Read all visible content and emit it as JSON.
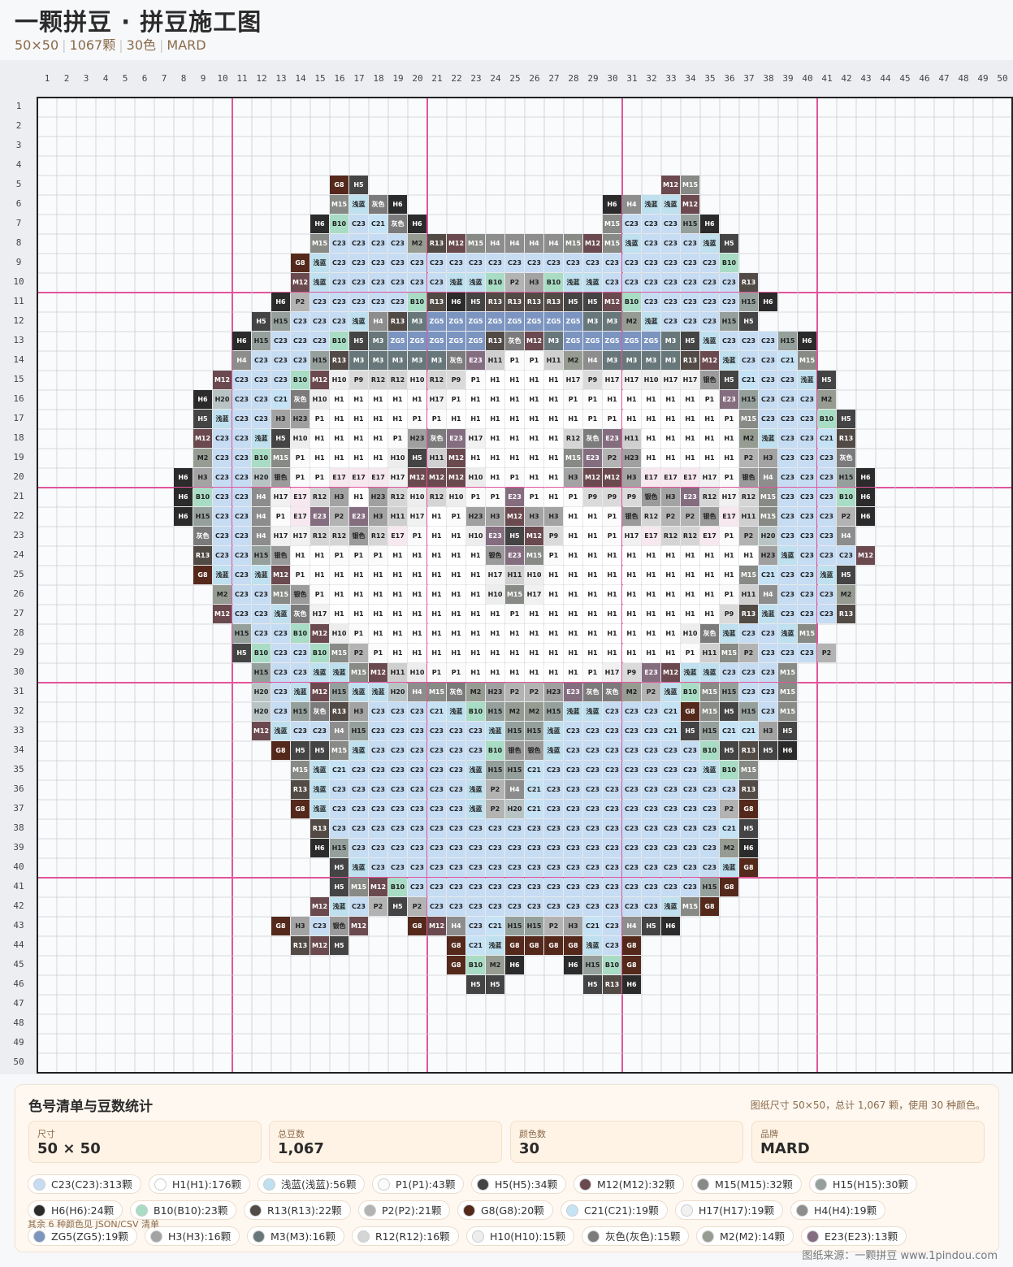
{
  "header": {
    "title": "一颗拼豆 · 拼豆施工图",
    "size": "50×50",
    "beads": "1067颗",
    "colors": "30色",
    "brand": "MARD"
  },
  "grid": {
    "cols": 50,
    "rows": 50,
    "pattern": [
      "",
      "",
      "",
      "",
      "16:G8,H5|33:M12,M15",
      "16:M15,浅蓝,灰色,H6|30:H6,H4,浅蓝,浅蓝,M12",
      "15:H6,B10,C23,C21,灰色,H6|30:M15,C23,C23,C23,H15,H6",
      "15:M15,C23,C23,C23,C23,M2,R13,M12,M15,H4,H4,H4,H4,M15,M12,M15,浅蓝,C23,C23,C23,浅蓝,H5",
      "14:G8,浅蓝,C23,C23,C23,C23,C23,C23,C23,C23,C23,C23,C23,C23,C23,C23,C23,C23,C23,C23,C23,C23,B10",
      "14:M12,浅蓝,C23,C23,C23,C23,C23,C23,浅蓝,浅蓝,B10,P2,H3,B10,浅蓝,浅蓝,C23,C23,C23,C23,C23,C23,C23,R13",
      "13:H6,P2,C23,C23,C23,C23,C23,B10,R13,H6,H5,R13,R13,R13,R13,H5,H5,M12,B10,C23,C23,C23,C23,C23,H15,H6",
      "12:H5,H15,C23,C23,C23,浅蓝,H4,R13,M3,ZG5,ZG5,ZG5,ZG5,ZG5,ZG5,ZG5,ZG5,M3,M3,M2,浅蓝,C23,C23,C23,H15,H5",
      "11:H6,H15,C23,C23,C23,B10,H5,M3,ZG5,ZG5,ZG5,ZG5,ZG5,R13,灰色,M12,M3,ZG5,ZG5,ZG5,ZG5,ZG5,M3,H5,浅蓝,C23,C23,C23,H15,H6",
      "11:H4,C23,C23,C23,H15,R13,M3,M3,M3,M3,M3,灰色,E23,H11,P1,P1,H11,M2,H4,M3,M3,M3,M3,R13,M12,浅蓝,C23,C23,C21,M15",
      "10:M12,C23,C23,C23,B10,M12,H10,P9,R12,R12,H10,R12,P9,P1,H1,H1,H1,H1,H17,P9,H17,H17,H10,H17,H17,银色,H5,C21,C23,C23,浅蓝,H5",
      "9:H6,H20,C23,C23,C21,灰色,H10,H1,H1,H1,H1,H1,H17,P1,H1,H1,H1,H1,H1,P1,P1,H1,H1,H1,H1,H1,P1,E23,H15,C23,C23,C23,M2",
      "9:H5,浅蓝,C23,C23,H3,H23,P1,H1,H1,H1,H1,P1,P1,H1,H1,H1,H1,H1,H1,H1,P1,P1,H1,H1,H1,H1,H1,P1,M15,C23,C23,C23,B10,H5",
      "9:M12,C23,C23,浅蓝,H5,H10,H1,H1,H1,H1,P1,H23,灰色,E23,H17,H1,H1,H1,H1,R12,灰色,E23,H11,H1,H1,H1,H1,H1,M2,浅蓝,C23,C23,C21,R13",
      "9:M2,C23,C23,B10,M15,P1,H1,H1,H1,H1,H10,H5,H11,M12,H1,H1,H1,H1,H1,M15,E23,P2,H23,H1,H1,H1,H1,H1,P2,H3,C23,C23,C23,灰色",
      "8:H6,H3,C23,C23,H20,银色,P1,P1,E17,E17,E17,H17,M12,M12,M12,H10,H1,P1,H1,H1,H3,M12,M12,H3,E17,E17,E17,H17,P1,银色,H4,C23,C23,C23,H15,H6",
      "8:H6,B10,C23,C23,H4,H17,E17,R12,H3,H1,H23,R12,H10,R12,H10,P1,P1,E23,P1,H1,P1,P9,P9,P9,银色,H3,E23,R12,H17,R12,M15,C23,C23,C23,B10,H6",
      "8:H6,H15,C23,C23,H4,P1,E17,E23,P2,E23,H3,H11,H17,H1,P1,H23,H3,M12,H3,H3,H1,H1,P1,银色,R12,P2,P2,银色,E17,H11,M15,C23,C23,C23,P2,H6",
      "9:灰色,C23,C23,H4,H17,H17,R12,R12,银色,R12,E17,P1,H1,H1,H10,E23,H5,M12,P9,H1,H1,P1,H17,E17,R12,R12,E17,P1,P2,H20,C23,C23,C23,H4",
      "9:R13,C23,C23,H15,银色,H1,H1,P1,P1,P1,H1,H1,H1,H1,H1,银色,E23,M15,P1,H1,H1,H1,H1,H1,H1,H1,H1,H1,H1,H23,浅蓝,C23,C23,C23,M12",
      "9:G8,浅蓝,C23,浅蓝,M12,P1,H1,H1,H1,H1,H1,H1,H1,H1,H1,H17,H11,H10,H1,H1,H1,H1,H1,H1,H1,H1,H1,H1,M15,C21,C23,C23,浅蓝,H5",
      "10:M2,C23,C23,M15,银色,P1,H1,H1,H1,H1,H1,H1,H1,H1,H10,M15,H17,H1,H1,H1,H1,H1,H1,H1,H1,H1,P1,H11,H4,C23,C23,C23,M2",
      "10:M12,C23,C23,浅蓝,灰色,H17,H1,H1,H1,H1,H1,H1,H1,H1,H1,P1,H1,H1,H1,H1,H1,H1,H1,H1,H1,H1,P9,R13,浅蓝,C23,C23,C23,R13",
      "11:H15,C23,C23,B10,M12,H10,P1,H1,H1,H1,H1,H1,H1,H1,H1,H1,H1,H1,H1,H1,H1,H1,H1,H10,灰色,浅蓝,C23,C23,浅蓝,M15",
      "11:H5,B10,C23,C23,B10,M15,P2,P1,H1,H1,H1,H1,H1,H1,H1,H1,H1,H1,H1,H1,H1,H1,H1,P1,H11,M15,P2,C23,C23,C23,P2",
      "12:H15,C23,C23,浅蓝,浅蓝,M15,M12,H11,H10,P1,P1,H1,H1,H1,H1,H1,H1,P1,H17,P9,E23,M12,浅蓝,浅蓝,C23,C23,C23,M15",
      "12:H20,C23,浅蓝,M12,H15,浅蓝,浅蓝,H20,H4,M15,灰色,M2,H23,P2,P2,H23,E23,灰色,灰色,M2,P2,浅蓝,B10,M15,H15,C23,C23,M15",
      "12:H20,C23,H15,灰色,R13,H3,C23,C23,C23,C21,浅蓝,B10,H15,M2,M2,H15,浅蓝,浅蓝,C23,C23,C23,C21,G8,M15,H5,H15,C23,M15",
      "12:M12,浅蓝,C23,C23,H4,H15,C23,C23,C23,C23,C23,C23,浅蓝,H15,H15,浅蓝,C23,C23,C23,C23,C23,C21,H5,H15,C21,C21,H3,H5",
      "13:G8,H5,H5,M15,浅蓝,C23,C23,C23,C23,C23,C23,B10,银色,银色,浅蓝,C23,C23,C23,C23,C23,C23,C23,B10,H5,R13,H5,H6",
      "14:M15,浅蓝,C21,C23,C23,C23,C23,C23,C23,浅蓝,H15,H15,C21,C23,C23,C23,C23,C23,C23,C23,C23,浅蓝,B10,M15",
      "14:R13,浅蓝,C23,C23,C23,C23,C23,C23,C23,浅蓝,P2,H4,C21,C23,C23,C23,C23,C23,C23,C23,C23,C23,C23,R13",
      "14:G8,浅蓝,C23,C23,C23,C23,C23,C23,C23,浅蓝,P2,H20,C21,C23,C23,C23,C23,C23,C23,C23,C23,C23,P2,G8",
      "15:R13,C23,C23,C23,C23,C23,C23,C23,C23,C23,C23,C23,C23,C23,C23,C23,C23,C23,C23,C23,C23,C21,H5",
      "15:H6,H15,C23,C23,C23,C23,C23,C23,C23,C23,C23,C23,C23,C23,C23,C23,C23,C23,C23,C23,C23,M2,H6",
      "16:H5,浅蓝,C23,C23,C23,C23,C23,C23,C23,C23,C23,C23,C23,C23,C23,C23,C23,C23,C23,C23,浅蓝,G8",
      "16:H5,M15,M12,B10,C23,C23,C23,C23,C23,C23,C23,C23,C23,C23,C23,C23,C23,C23,C23,H15,G8",
      "15:M12,浅蓝,C23,P2,H5,P2,C23,C23,C23,C23,C23,C23,C23,C23,C23,C23,C23,C23,浅蓝,M15,G8",
      "13:G8,H3,C23,银色,M12|20:G8,M12,H4,C23,C21,H15,H15,P2,H3,C21,C23,H4,H5,H6",
      "14:R13,M12,H5|22:G8,C21,浅蓝,G8,G8,G8,G8,浅蓝,C23,G8",
      "22:G8,B10,M2,H6|28:H6,H15,B10,G8",
      "23:H5,H5|29:H5,R13,H6",
      "",
      "",
      "",
      ""
    ]
  },
  "palette": {
    "C23": "#c6dcf3",
    "H1": "#ffffff",
    "浅蓝": "#bfe0ee",
    "P1": "#fbfbfb",
    "H5": "#444444",
    "M12": "#6b4a4f",
    "M15": "#878a85",
    "H15": "#95a09c",
    "H6": "#2b2b2b",
    "B10": "#a8dcc4",
    "R13": "#524a45",
    "P2": "#b3b3b3",
    "G8": "#54291b",
    "C21": "#c6e3f6",
    "H17": "#f1f1f1",
    "H4": "#8d8d8d",
    "ZG5": "#7c94c0",
    "H3": "#a3a3a3",
    "M3": "#68787a",
    "R12": "#d5d5d5",
    "H10": "#ededed",
    "灰色": "#7b7b7b",
    "M2": "#979c93",
    "E23": "#856d80",
    "P9": "#dadada",
    "H11": "#cfcfcf",
    "E17": "#f7e7ee",
    "H23": "#a0a0a0",
    "银色": "#9b9b9b",
    "H20": "#b8c4c3"
  },
  "panel": {
    "title": "色号清单与豆数统计",
    "summary": "图纸尺寸 50×50，总计 1,067 颗，使用 30 种颜色。",
    "stats": [
      {
        "label": "尺寸",
        "value": "50 × 50"
      },
      {
        "label": "总豆数",
        "value": "1,067"
      },
      {
        "label": "颜色数",
        "value": "30"
      },
      {
        "label": "品牌",
        "value": "MARD"
      }
    ],
    "chips": [
      {
        "label": "C23(C23):313颗",
        "code": "C23"
      },
      {
        "label": "H1(H1):176颗",
        "code": "H1"
      },
      {
        "label": "浅蓝(浅蓝):56颗",
        "code": "浅蓝"
      },
      {
        "label": "P1(P1):43颗",
        "code": "P1"
      },
      {
        "label": "H5(H5):34颗",
        "code": "H5"
      },
      {
        "label": "M12(M12):32颗",
        "code": "M12"
      },
      {
        "label": "M15(M15):32颗",
        "code": "M15"
      },
      {
        "label": "H15(H15):30颗",
        "code": "H15"
      },
      {
        "label": "H6(H6):24颗",
        "code": "H6"
      },
      {
        "label": "B10(B10):23颗",
        "code": "B10"
      },
      {
        "label": "R13(R13):22颗",
        "code": "R13"
      },
      {
        "label": "P2(P2):21颗",
        "code": "P2"
      },
      {
        "label": "G8(G8):20颗",
        "code": "G8"
      },
      {
        "label": "C21(C21):19颗",
        "code": "C21"
      },
      {
        "label": "H17(H17):19颗",
        "code": "H17"
      },
      {
        "label": "H4(H4):19颗",
        "code": "H4"
      },
      {
        "label": "ZG5(ZG5):19颗",
        "code": "ZG5"
      },
      {
        "label": "H3(H3):16颗",
        "code": "H3"
      },
      {
        "label": "M3(M3):16颗",
        "code": "M3"
      },
      {
        "label": "R12(R12):16颗",
        "code": "R12"
      },
      {
        "label": "H10(H10):15颗",
        "code": "H10"
      },
      {
        "label": "灰色(灰色):15颗",
        "code": "灰色"
      },
      {
        "label": "M2(M2):14颗",
        "code": "M2"
      },
      {
        "label": "E23(E23):13颗",
        "code": "E23"
      }
    ],
    "more_note": "其余 6 种颜色见 JSON/CSV 清单"
  },
  "footer": {
    "source": "图纸来源：一颗拼豆 www.1pindou.com"
  }
}
